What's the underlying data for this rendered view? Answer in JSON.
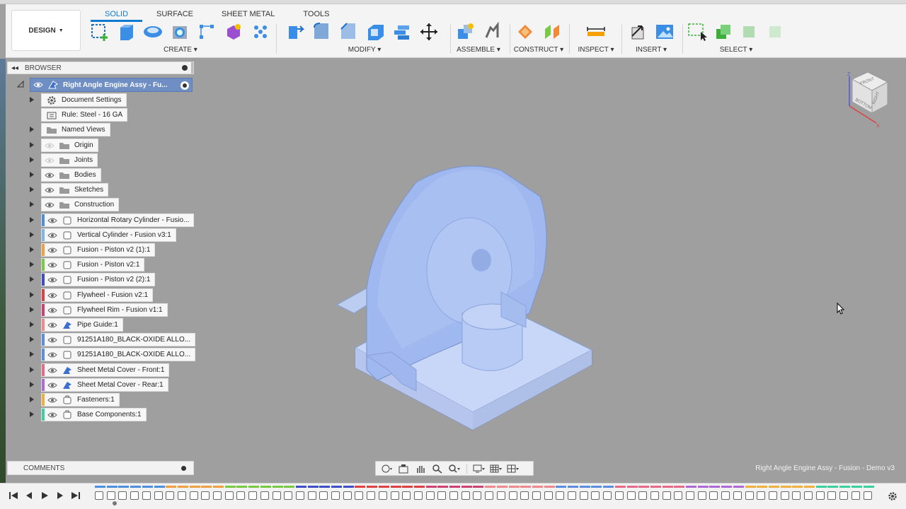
{
  "toolbar": {
    "tabs": [
      "SOLID",
      "SURFACE",
      "SHEET METAL",
      "TOOLS"
    ],
    "active_tab": "SOLID",
    "workspace": "DESIGN",
    "groups": {
      "create": "CREATE",
      "modify": "MODIFY",
      "assemble": "ASSEMBLE",
      "construct": "CONSTRUCT",
      "inspect": "INSPECT",
      "insert": "INSERT",
      "select": "SELECT"
    }
  },
  "browser": {
    "title": "BROWSER",
    "root": "Right Angle Engine Assy - Fu...",
    "items": [
      {
        "label": "Document Settings",
        "type": "settings",
        "eye": false,
        "color": null,
        "expand": true
      },
      {
        "label": "Rule: Steel - 16 GA",
        "type": "rule",
        "eye": false,
        "color": null,
        "expand": false
      },
      {
        "label": "Named Views",
        "type": "folder",
        "eye": false,
        "color": null,
        "expand": true
      },
      {
        "label": "Origin",
        "type": "folder",
        "eye": "faded",
        "color": null,
        "expand": true
      },
      {
        "label": "Joints",
        "type": "folder",
        "eye": "faded",
        "color": null,
        "expand": true
      },
      {
        "label": "Bodies",
        "type": "folder",
        "eye": true,
        "color": null,
        "expand": true
      },
      {
        "label": "Sketches",
        "type": "folder",
        "eye": true,
        "color": null,
        "expand": true
      },
      {
        "label": "Construction",
        "type": "folder",
        "eye": true,
        "color": null,
        "expand": true
      },
      {
        "label": "Horizontal Rotary Cylinder - Fusio...",
        "type": "component",
        "eye": true,
        "color": "#4b8fe0",
        "expand": true
      },
      {
        "label": "Vertical Cylinder - Fusion v3:1",
        "type": "component",
        "eye": true,
        "color": "#7fb6e8",
        "expand": true
      },
      {
        "label": "Fusion - Piston v2 (1):1",
        "type": "component",
        "eye": true,
        "color": "#f0a040",
        "expand": true
      },
      {
        "label": "Fusion - Piston v2:1",
        "type": "component",
        "eye": true,
        "color": "#7ac943",
        "expand": true
      },
      {
        "label": "Fusion - Piston v2 (2):1",
        "type": "component",
        "eye": true,
        "color": "#3d4fc8",
        "expand": true
      },
      {
        "label": "Flywheel - Fusion v2:1",
        "type": "component",
        "eye": true,
        "color": "#e04040",
        "expand": true
      },
      {
        "label": "Flywheel Rim - Fusion v1:1",
        "type": "component",
        "eye": true,
        "color": "#d04070",
        "expand": true
      },
      {
        "label": "Pipe Guide:1",
        "type": "sheetmetal",
        "eye": true,
        "color": "#f08a8a",
        "expand": true
      },
      {
        "label": "91251A180_BLACK-OXIDE ALLO...",
        "type": "component",
        "eye": true,
        "color": "#5b8ee0",
        "expand": true
      },
      {
        "label": "91251A180_BLACK-OXIDE ALLO...",
        "type": "component",
        "eye": true,
        "color": "#5b8ee0",
        "expand": true
      },
      {
        "label": "Sheet Metal Cover - Front:1",
        "type": "sheetmetal",
        "eye": true,
        "color": "#e86a8a",
        "expand": true
      },
      {
        "label": "Sheet Metal Cover - Rear:1",
        "type": "sheetmetal",
        "eye": true,
        "color": "#b06ad8",
        "expand": true
      },
      {
        "label": "Fasteners:1",
        "type": "link",
        "eye": true,
        "color": "#f0b040",
        "expand": true
      },
      {
        "label": "Base Components:1",
        "type": "link",
        "eye": true,
        "color": "#3ad0a0",
        "expand": true
      }
    ]
  },
  "comments": {
    "title": "COMMENTS"
  },
  "document_name": "Right Angle Engine Assy - Fusion - Demo v3",
  "viewcube": {
    "faces": [
      "FRONT",
      "BOTTOM",
      "RIGHT"
    ],
    "axes": [
      "Z",
      "X"
    ]
  },
  "colors": {
    "accent": "#0f7ad0",
    "model": "#9fb8ef",
    "browser_root": "#6f8fc4"
  }
}
